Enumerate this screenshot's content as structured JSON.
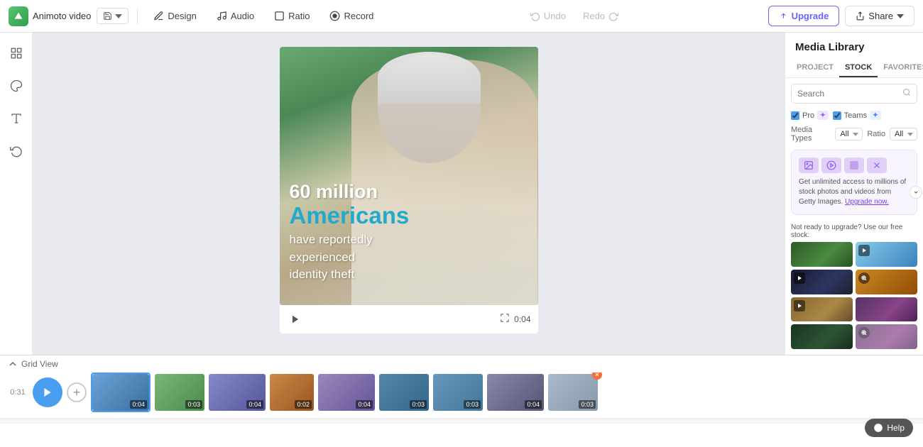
{
  "topbar": {
    "logo_alt": "Animoto logo",
    "project_name": "Animoto video",
    "save_label": "Save",
    "design_label": "Design",
    "audio_label": "Audio",
    "ratio_label": "Ratio",
    "record_label": "Record",
    "undo_label": "Undo",
    "redo_label": "Redo",
    "upgrade_label": "Upgrade",
    "share_label": "Share"
  },
  "tools": [
    {
      "name": "grid-tool",
      "label": "Grid"
    },
    {
      "name": "color-tool",
      "label": "Color"
    },
    {
      "name": "text-tool",
      "label": "Text"
    },
    {
      "name": "rotate-tool",
      "label": "Rotate"
    }
  ],
  "video": {
    "text1": "60 million",
    "text2": "Americans",
    "text3": "have reportedly\nexperienced\nidentity theft",
    "time": "0:04",
    "play_label": "Play"
  },
  "timeline": {
    "grid_view_label": "Grid View",
    "counter": "0:31",
    "clips": [
      {
        "id": 1,
        "duration": "0:04",
        "color": "clip-color-1",
        "selected": true
      },
      {
        "id": 2,
        "duration": "0:03",
        "color": "clip-color-2",
        "selected": false
      },
      {
        "id": 3,
        "duration": "0:04",
        "color": "clip-color-3",
        "selected": false
      },
      {
        "id": 4,
        "duration": "0:02",
        "color": "clip-color-4",
        "selected": false
      },
      {
        "id": 5,
        "duration": "0:04",
        "color": "clip-color-5",
        "selected": false
      },
      {
        "id": 6,
        "duration": "0:03",
        "color": "clip-color-6",
        "selected": false
      },
      {
        "id": 7,
        "duration": "0:03",
        "color": "clip-color-7",
        "selected": false
      },
      {
        "id": 8,
        "duration": "0:04",
        "color": "clip-color-8",
        "selected": false
      },
      {
        "id": 9,
        "duration": "0:03",
        "color": "clip-color-9",
        "selected": false,
        "last": true
      }
    ]
  },
  "media_library": {
    "title": "Media Library",
    "tabs": [
      {
        "label": "PROJECT",
        "active": false
      },
      {
        "label": "STOCK",
        "active": true
      },
      {
        "label": "FAVORITES",
        "active": false
      }
    ],
    "search_placeholder": "Search",
    "filters": {
      "pro_label": "Pro",
      "pro_badge": "✦",
      "teams_label": "Teams",
      "teams_badge": "✦",
      "media_type_label": "Media Types",
      "media_type_value": "All",
      "ratio_label": "Ratio",
      "ratio_value": "All"
    },
    "upgrade_card": {
      "text": "Get unlimited access to millions of stock photos and videos from Getty Images.",
      "link_text": "Upgrade now."
    },
    "not_ready_text": "Not ready to upgrade? Use our free stock:",
    "stock_items": [
      {
        "id": 1,
        "color": "stock-green",
        "type": "image"
      },
      {
        "id": 2,
        "color": "stock-sky",
        "type": "video"
      },
      {
        "id": 3,
        "color": "stock-dark",
        "type": "video"
      },
      {
        "id": 4,
        "color": "stock-autumn",
        "type": "image"
      },
      {
        "id": 5,
        "color": "stock-temple",
        "type": "video"
      },
      {
        "id": 6,
        "color": "stock-purple",
        "type": "image"
      },
      {
        "id": 7,
        "color": "stock-leaf",
        "type": "image"
      },
      {
        "id": 8,
        "color": "stock-purple",
        "type": "image"
      }
    ]
  },
  "help": {
    "label": "Help"
  }
}
